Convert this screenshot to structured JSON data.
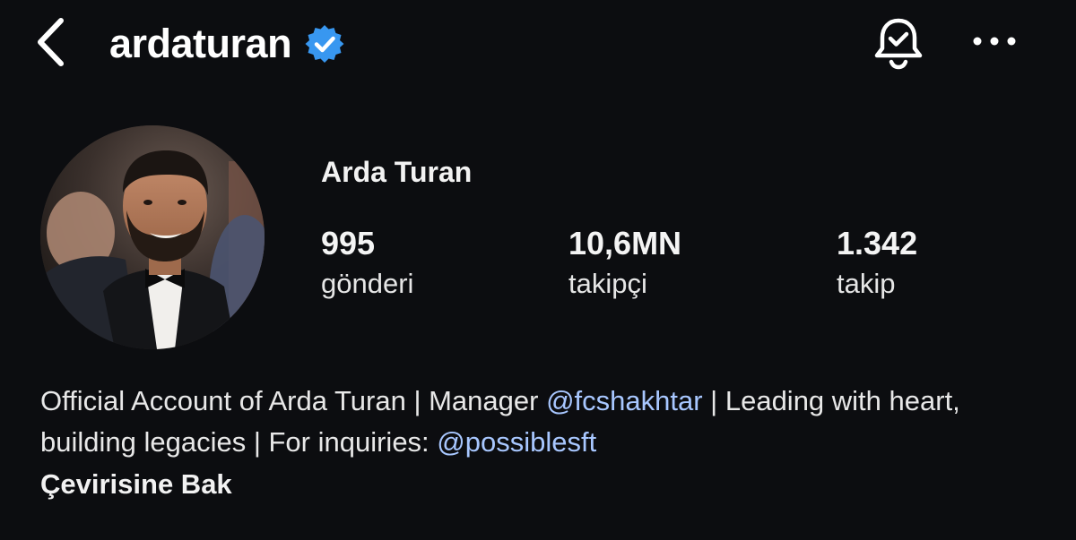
{
  "header": {
    "username": "ardaturan",
    "verified_color": "#3897f0",
    "icons": [
      "chevron-left-icon",
      "verified-badge-icon",
      "bell-check-icon",
      "more-horizontal-icon"
    ]
  },
  "profile": {
    "full_name": "Arda Turan",
    "stats": {
      "posts": {
        "value": "995",
        "label": "gönderi"
      },
      "followers": {
        "value": "10,6MN",
        "label": "takipçi"
      },
      "following": {
        "value": "1.342",
        "label": "takip"
      }
    }
  },
  "bio": {
    "part1": "Official Account of Arda Turan | Manager ",
    "mention1": "@fcshakhtar",
    "part2": " | Leading with heart, building legacies | For inquiries: ",
    "mention2": "@possiblesft",
    "translate_label": "Çevirisine Bak"
  },
  "colors": {
    "background": "#0c0d10",
    "text": "#f5f5f5",
    "mention": "#a8c7ff"
  }
}
